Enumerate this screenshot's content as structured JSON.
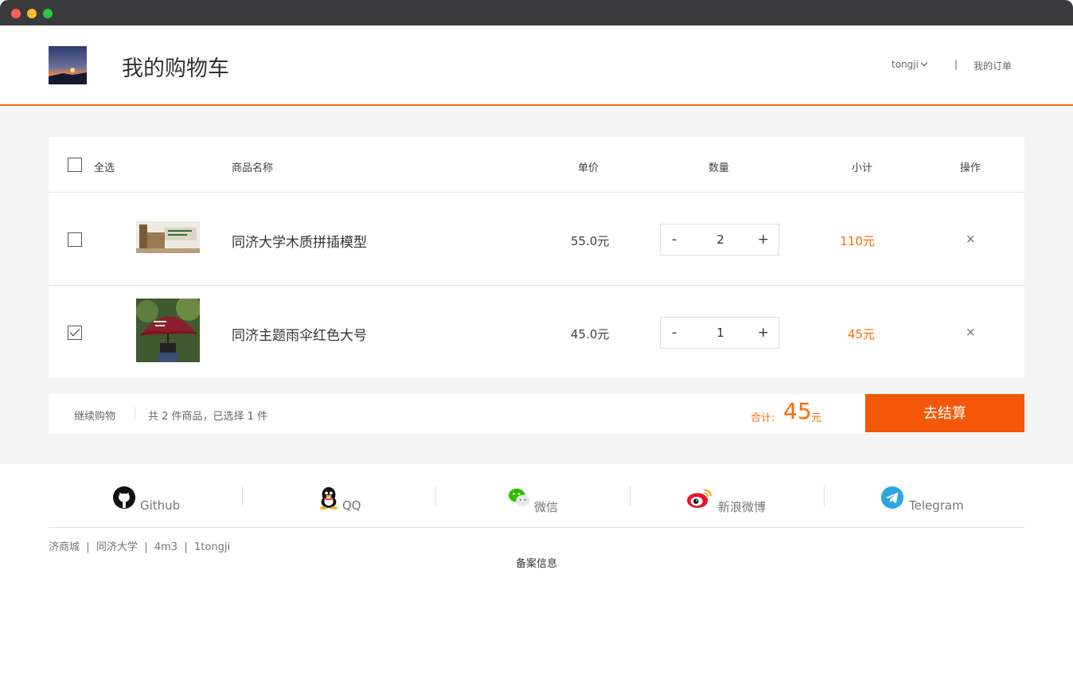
{
  "header": {
    "title": "我的购物车",
    "username": "tongji",
    "separator": "|",
    "orders_link": "我的订单"
  },
  "cart": {
    "columns": {
      "select_all": "全选",
      "name": "商品名称",
      "price": "单价",
      "quantity": "数量",
      "subtotal": "小计",
      "action": "操作"
    },
    "items": [
      {
        "name": "同济大学木质拼插模型",
        "price": "55.0元",
        "quantity": "2",
        "subtotal": "110元",
        "checked": false,
        "minus": "-",
        "plus": "+",
        "remove": "×"
      },
      {
        "name": "同济主题雨伞红色大号",
        "price": "45.0元",
        "quantity": "1",
        "subtotal": "45元",
        "checked": true,
        "minus": "-",
        "plus": "+",
        "remove": "×"
      }
    ]
  },
  "summary": {
    "continue": "继续购物",
    "count_text": "共 2 件商品，已选择 1 件",
    "total_label": "合计:",
    "total_value": "45",
    "total_unit": "元",
    "checkout": "去结算"
  },
  "footer": {
    "social": [
      {
        "label": "Github",
        "icon": "github-icon"
      },
      {
        "label": "QQ",
        "icon": "qq-icon"
      },
      {
        "label": "微信",
        "icon": "wechat-icon"
      },
      {
        "label": "新浪微博",
        "icon": "weibo-icon"
      },
      {
        "label": "Telegram",
        "icon": "telegram-icon"
      }
    ],
    "links": [
      "济商城",
      "同济大学",
      "4m3",
      "1tongji"
    ],
    "link_sep": "|",
    "beian": "备案信息"
  },
  "colors": {
    "accent": "#ff6700",
    "checkout_bg": "#f25807"
  }
}
